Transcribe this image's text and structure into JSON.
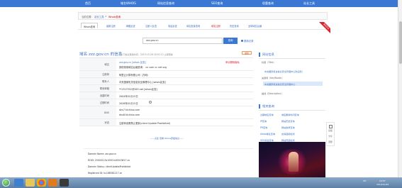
{
  "nav": [
    "首页",
    "域名WHOIS",
    "网站信息查询",
    "SEO查询",
    "权重查询",
    "站长工具"
  ],
  "breadcrumb": {
    "prefix": "当前位置：",
    "home": "站长工具",
    "sep": ">",
    "current": "Whois查询"
  },
  "tools": {
    "tabs": [
      "Whois查询",
      "最新注册",
      "邮箱反查",
      "注册人反查",
      "电话反查",
      "域名批量查询",
      "域名注册",
      "历史查询",
      "全球域名后缀"
    ],
    "active_index": 0,
    "highlight_index": 6,
    "ribbon": "查询历史"
  },
  "search": {
    "value": "zzz.gov.cn",
    "button": "查询",
    "update_link": "更新记录"
  },
  "info": {
    "title": "域名 zzz.gov.cn 的信息",
    "subtitle": "以下信息更新时间：2019-10-26 18:51:12 立即更新",
    "badge": "最新",
    "rows": [
      {
        "label": "域名",
        "lines": [
          "zzz.gov.cn [whois 反查]",
          "其他常用域名后缀查询：  cn  com  cc  net  org"
        ],
        "note": "申请删除隐私"
      },
      {
        "label": "注册商",
        "lines": [
          "阿里云计算有限公司（万网）"
        ]
      },
      {
        "label": "联系人",
        "lines": [
          "中央国家机关信息安全管理中心 [whois反查]"
        ]
      },
      {
        "label": "联系邮箱",
        "lines": [
          "**1327552@263.net [whois反查]"
        ]
      },
      {
        "label": "创建时间",
        "lines": [
          "2004年01月15日"
        ]
      },
      {
        "label": "过期时间",
        "lines": [
          "2026年01月15日"
        ]
      },
      {
        "label": "DNS",
        "lines": [
          "dns7.hichina.com",
          "dns8.hichina.com"
        ]
      },
      {
        "label": "状态",
        "lines": [
          "注册商设置禁止更新(client Update Prohibited)"
        ]
      }
    ],
    "more": "——点此 查看 Whois原始信息——"
  },
  "raw_whois": [
    "Domain Name: zzz.gov.cn",
    "ROID: 20040115s10001s00023817-cn",
    "Domain Status: clientUpdateProhibited",
    "Registrant ID: hc186581217-cn",
    "Registrant: 中央国家机关信息安全管理中心"
  ],
  "sidebar": {
    "site_info_title": "网站信息",
    "title_label": "标题（Title）：",
    "title_value": "中央国家机关信息安全管理中心欢迎您！",
    "keywords_label": "关键词（KeyWords）：",
    "keywords_value": "中央国家机关信息安全管理中心",
    "description_label": "描述（Description）：",
    "related_title": "相关查询",
    "related_links": [
      "过期域名查询",
      "域名删除时间查询",
      "IP查询",
      "网站历史查询",
      "PR查询",
      "网站收录查询",
      "Alexa排名查询",
      "友情链接检测",
      "SEO综合查询",
      "网站死链检测"
    ]
  },
  "side_tools": [
    "反馈",
    "分享",
    "顶部"
  ],
  "taskbar": {
    "lang": "CH",
    "time": "14:57",
    "date": "2019/10/26"
  }
}
